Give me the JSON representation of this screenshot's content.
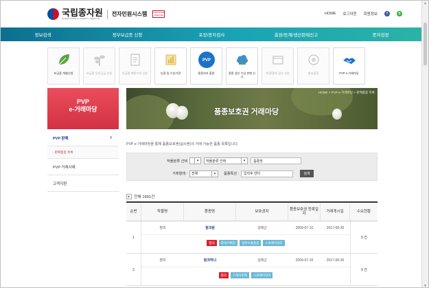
{
  "header": {
    "logo_name": "국립종자원",
    "logo_sub": "KOREA SEED & VARIETY SERVICE",
    "system_name": "전자민원시스템",
    "badge_text": "CERTIFIED SERVICE",
    "links": [
      "HOME",
      "로그아웃",
      "회원정보"
    ],
    "sns": [
      {
        "label": "f",
        "color": "#3b5998"
      },
      {
        "label": "b",
        "color": "#3cb043"
      }
    ]
  },
  "main_nav": [
    "정보검색",
    "정부보급종 신청",
    "포장/종자검사",
    "출원/등재/생산판매신고",
    "종자검정"
  ],
  "icon_menu": [
    {
      "label": "보급종 개별신청",
      "icon": "leaf-icon",
      "color": "#5aa63f",
      "dim": false
    },
    {
      "label": "보급종 무인공급 신청",
      "icon": "plant-icon",
      "color": "#bdbdbd",
      "dim": true
    },
    {
      "label": "보급종 행정기관 신청",
      "icon": "document-icon",
      "color": "#bdbdbd",
      "dim": true
    },
    {
      "label": "농협 및 수송기관",
      "icon": "chart-icon",
      "color": "#e0b84a",
      "dim": false
    },
    {
      "label": "품종보호 출원",
      "icon": "pvp-icon",
      "color": "#1a73c9",
      "dim": false
    },
    {
      "label": "품종 생산 수입 판매 신고",
      "icon": "cloud-icon",
      "color": "#3f8fcf",
      "dim": false
    },
    {
      "label": "포장/종자 검사 신청",
      "icon": "box-icon",
      "color": "#bdbdbd",
      "dim": true
    },
    {
      "label": "종자검정",
      "icon": "seal-icon",
      "color": "#bdbdbd",
      "dim": true
    },
    {
      "label": "PVP e-거래마당",
      "icon": "handshake-icon",
      "color": "#1a73c9",
      "dim": false
    }
  ],
  "sidebar": {
    "title1": "PVP",
    "title2": "e-거래마당",
    "items": [
      {
        "label": "PVP 판매",
        "active": true,
        "sub": false
      },
      {
        "label": "- 판매품종 목록",
        "active": false,
        "sub": true
      },
      {
        "label": "PVP 거래사례",
        "active": false,
        "sub": false
      },
      {
        "label": "고객지원",
        "active": false,
        "sub": false
      }
    ]
  },
  "banner": {
    "title": "품종보호권 거래마당",
    "breadcrumb": "HOME > PVP e-거래마당 > 판매품종 목록"
  },
  "description": "PVP e-거래마당을 통해 품종보호권(실시권)의 거래 가능한 품종 목록입니다.",
  "search": {
    "label_crop": "작물분류 선택",
    "crop_select1": "작물분류 선택",
    "crop_select2": "작물분류 선택",
    "variety_placeholder": "품종명",
    "label_trade": "거래형태 :",
    "trade_select": "전체",
    "label_feature": "품종특성 :",
    "feature_placeholder": "입력후 엔터",
    "button": "검색"
  },
  "total": "전체 1891건",
  "table": {
    "headers": [
      "순번",
      "작물명",
      "품종명",
      "보호권자",
      "품종보호권 등록일자",
      "거래게시일",
      "수요현황"
    ],
    "rows": [
      {
        "no": "1",
        "crop": "장미",
        "variety": "핑크원",
        "holder": "김태근",
        "reg_date": "2009-07-10",
        "post_date": "2017-08-30",
        "demand": "0 건",
        "tags": [
          {
            "text": "협의",
            "color": "red"
          },
          {
            "text": "화색기뻐짐",
            "color": "blue"
          },
          {
            "text": "일본수출품종",
            "color": "blue"
          },
          {
            "text": "스프레이장미",
            "color": "blue"
          }
        ]
      },
      {
        "no": "2",
        "crop": "장미",
        "variety": "핑크하나",
        "holder": "김태근",
        "reg_date": "2009-07-10",
        "post_date": "2017-08-30",
        "demand": "0 건",
        "tags": [
          {
            "text": "협의",
            "color": "red"
          },
          {
            "text": "드레이춘화",
            "color": "blue"
          },
          {
            "text": "스프레이장미",
            "color": "blue"
          }
        ]
      }
    ]
  }
}
